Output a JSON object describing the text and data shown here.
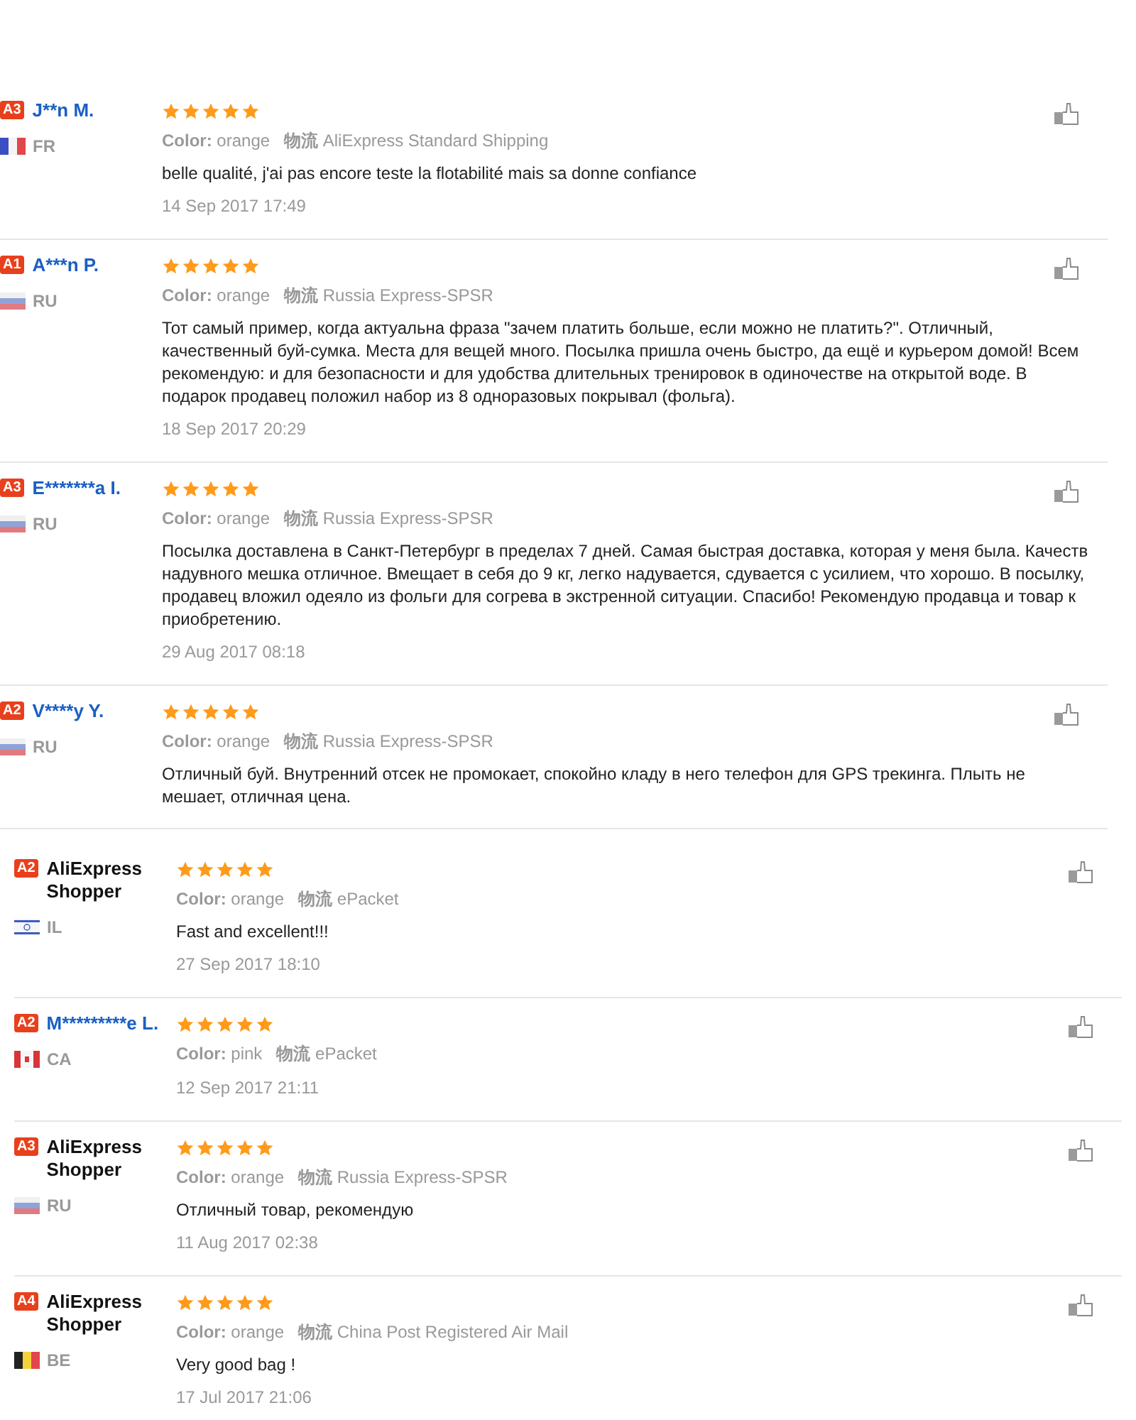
{
  "sections": [
    {
      "reviews": [
        {
          "badge": "A3",
          "name": "J**n M.",
          "highlighted": true,
          "flag": {
            "kind": "fr"
          },
          "country": "FR",
          "stars": 5,
          "color_label": "Color:",
          "color_value": "orange",
          "logistics_label": "物流",
          "shipping": "AliExpress Standard Shipping",
          "body": [
            "belle qualité, j'ai pas encore teste la flotabilité mais sa donne confiance"
          ],
          "date": "14 Sep 2017 17:49"
        },
        {
          "badge": "A1",
          "name": "A***n P.",
          "highlighted": true,
          "flag": {
            "kind": "ru"
          },
          "country": "RU",
          "stars": 5,
          "color_label": "Color:",
          "color_value": "orange",
          "logistics_label": "物流",
          "shipping": "Russia Express-SPSR",
          "body": [
            "Тот самый пример, когда актуальна фраза \"зачем платить больше, если можно не платить?\". Отличный,",
            "качественный буй-сумка. Места для вещей много. Посылка пришла очень быстро, да ещё и курьером домой! Всем",
            "рекомендую: и для безопасности и для удобства длительных тренировок в одиночестве на открытой воде. В",
            "подарок продавец положил набор из 8 одноразовых покрывал (фольга)."
          ],
          "date": "18 Sep 2017 20:29"
        },
        {
          "badge": "A3",
          "name": "E*******a I.",
          "highlighted": true,
          "flag": {
            "kind": "ru"
          },
          "country": "RU",
          "stars": 5,
          "color_label": "Color:",
          "color_value": "orange",
          "logistics_label": "物流",
          "shipping": "Russia Express-SPSR",
          "body": [
            "Посылка доставлена в Санкт-Петербург в пределах 7 дней. Самая быстрая доставка, которая у меня была. Качеств",
            "надувного мешка отличное. Вмещает в себя до 9 кг, легко надувается, сдувается с усилием, что хорошо. В посылку,",
            "продавец вложил одеяло из фольги для согрева в экстренной ситуации. Спасибо! Рекомендую продавца и товар к",
            "приобретению."
          ],
          "date": "29 Aug 2017 08:18"
        },
        {
          "badge": "A2",
          "name": "V****y Y.",
          "highlighted": true,
          "flag": {
            "kind": "ru"
          },
          "country": "RU",
          "stars": 5,
          "color_label": "Color:",
          "color_value": "orange",
          "logistics_label": "物流",
          "shipping": "Russia Express-SPSR",
          "body": [
            "Отличный буй. Внутренний отсек не промокает, спокойно кладу в него телефон для GPS трекинга. Плыть не",
            "мешает, отличная цена."
          ]
        }
      ]
    },
    {
      "reviews": [
        {
          "badge": "A2",
          "name": "AliExpress Shopper",
          "highlighted": false,
          "flag": {
            "kind": "il"
          },
          "country": "IL",
          "stars": 5,
          "color_label": "Color:",
          "color_value": "orange",
          "logistics_label": "物流",
          "shipping": "ePacket",
          "body": [
            "Fast and excellent!!!"
          ],
          "date": "27 Sep 2017 18:10"
        },
        {
          "badge": "A2",
          "name": "M*********e L.",
          "highlighted": true,
          "flag": {
            "kind": "ca"
          },
          "country": "CA",
          "stars": 5,
          "color_label": "Color:",
          "color_value": "pink",
          "logistics_label": "物流",
          "shipping": "ePacket",
          "date": "12 Sep 2017 21:11"
        },
        {
          "badge": "A3",
          "name": "AliExpress Shopper",
          "highlighted": false,
          "flag": {
            "kind": "ru"
          },
          "country": "RU",
          "stars": 5,
          "color_label": "Color:",
          "color_value": "orange",
          "logistics_label": "物流",
          "shipping": "Russia Express-SPSR",
          "body": [
            "Отличный товар, рекомендую"
          ],
          "date": "11 Aug 2017 02:38"
        },
        {
          "badge": "A4",
          "name": "AliExpress Shopper",
          "highlighted": false,
          "flag": {
            "kind": "be"
          },
          "country": "BE",
          "stars": 5,
          "color_label": "Color:",
          "color_value": "orange",
          "logistics_label": "物流",
          "shipping": "China Post Registered Air Mail",
          "body": [
            "Very good bag !"
          ],
          "date": "17 Jul 2017 21:06"
        }
      ]
    }
  ]
}
